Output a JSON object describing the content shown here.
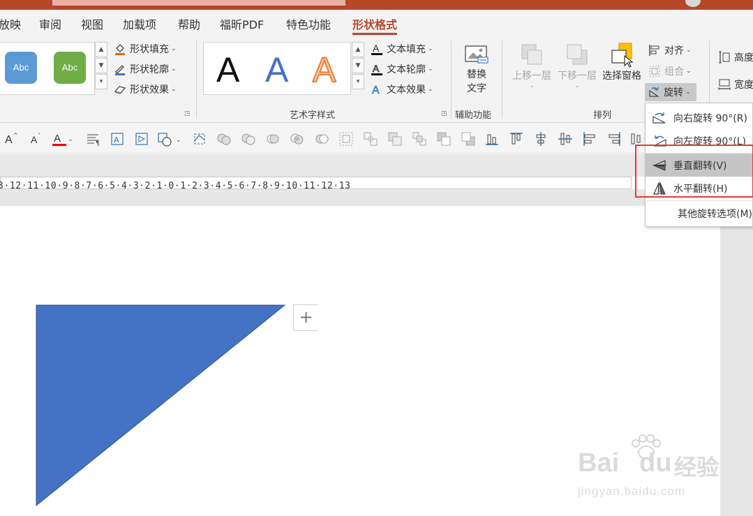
{
  "tabs": [
    {
      "label": "放映",
      "active": false
    },
    {
      "label": "审阅",
      "active": false
    },
    {
      "label": "视图",
      "active": false
    },
    {
      "label": "加载项",
      "active": false
    },
    {
      "label": "帮助",
      "active": false
    },
    {
      "label": "福昕PDF",
      "active": false
    },
    {
      "label": "特色功能",
      "active": false
    },
    {
      "label": "形状格式",
      "active": true
    }
  ],
  "shape_styles": {
    "samples": [
      {
        "label": "Abc",
        "color": "#5b9bd5"
      },
      {
        "label": "Abc",
        "color": "#70ad47"
      }
    ],
    "fill": "形状填充",
    "outline": "形状轮廓",
    "effects": "形状效果"
  },
  "wordart": {
    "samples": [
      {
        "letter": "A",
        "style": "black"
      },
      {
        "letter": "A",
        "style": "blue"
      },
      {
        "letter": "A",
        "style": "orange-outline"
      }
    ],
    "text_fill": "文本填充",
    "text_outline": "文本轮廓",
    "text_effects": "文本效果",
    "group_label": "艺术字样式"
  },
  "accessibility": {
    "alt_text_line1": "替换",
    "alt_text_line2": "文字",
    "group_label": "辅助功能"
  },
  "arrange": {
    "bring_forward": "上移一层",
    "send_backward": "下移一层",
    "selection_pane": "选择窗格",
    "align": "对齐",
    "group": "组合",
    "rotate": "旋转",
    "group_label": "排列"
  },
  "size": {
    "height": "高度",
    "width": "宽度"
  },
  "ruler": {
    "text": "3·12·11·10·9·8·7·6·5·4·3·2·1·0·1·2·3·4·5·6·7·8·9·10·11·12·13"
  },
  "rotate_menu": {
    "items": [
      {
        "label": "向右旋转 90°(R)",
        "icon": "rotate-right-icon"
      },
      {
        "label": "向左旋转 90°(L)",
        "icon": "rotate-left-icon"
      },
      {
        "label": "垂直翻转(V)",
        "icon": "flip-vertical-icon",
        "hover": true
      },
      {
        "label": "水平翻转(H)",
        "icon": "flip-horizontal-icon"
      },
      {
        "label": "其他旋转选项(M)",
        "icon": ""
      }
    ]
  },
  "colors": {
    "accent": "#b7472a",
    "shape_fill": "#4472c4",
    "highlight": "#e53935"
  },
  "watermark": {
    "brand": "Bai",
    "brand2": "du",
    "cn": "经验",
    "url": "jingyan.baidu.com"
  }
}
